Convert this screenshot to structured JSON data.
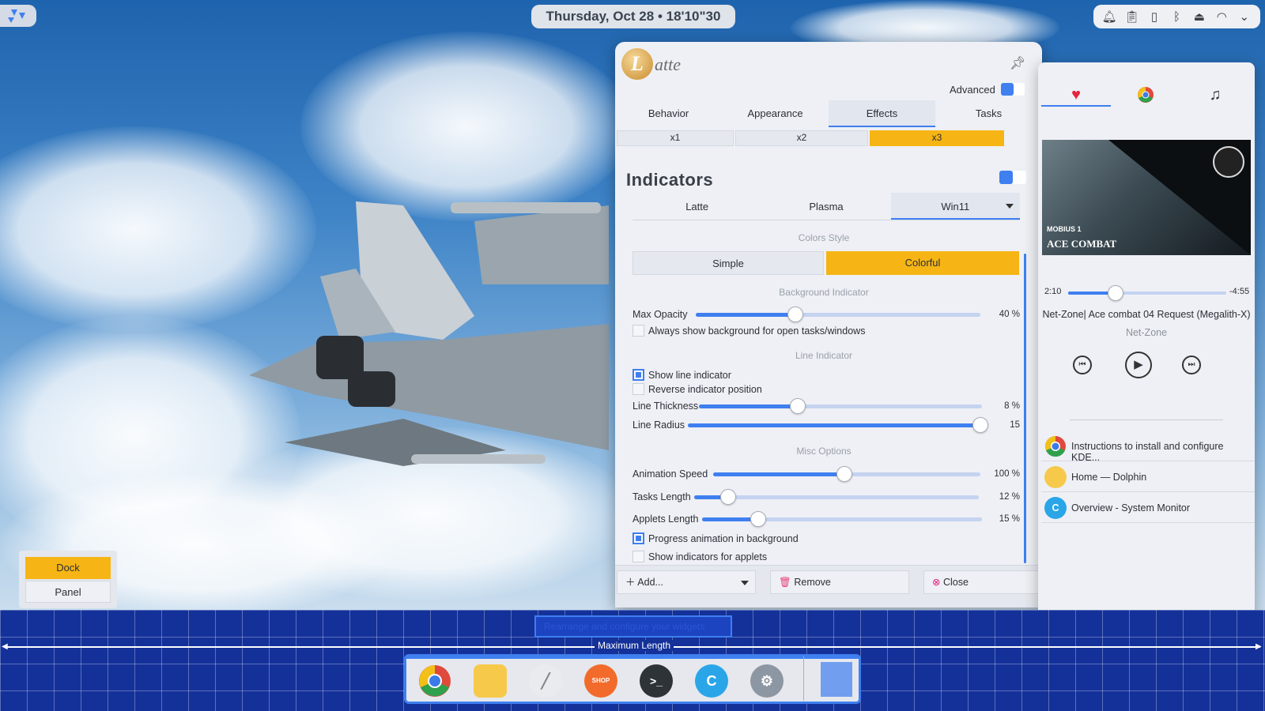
{
  "topbar": {
    "clock": "Thursday, Oct 28 • 18'10\"30"
  },
  "tray_icons": [
    "bell-icon",
    "clipboard-icon",
    "battery-icon",
    "bluetooth-icon",
    "usb-icon",
    "wifi-icon",
    "chevron-icon"
  ],
  "latte": {
    "logo_letter": "L",
    "logo_text": "atte",
    "advanced_label": "Advanced",
    "tabs": [
      "Behavior",
      "Appearance",
      "Effects",
      "Tasks"
    ],
    "active_tab": "Effects",
    "multipliers": [
      "x1",
      "x2",
      "x3"
    ],
    "indicators_title": "Indicators",
    "styles": [
      "Latte",
      "Plasma",
      "Win11"
    ],
    "colors_style_label": "Colors Style",
    "color_buttons": [
      "Simple",
      "Colorful"
    ],
    "bg_indicator_label": "Background Indicator",
    "max_opacity": {
      "label": "Max Opacity",
      "value": "40 %",
      "fraction": 0.35
    },
    "always_show_bg": "Always show background for open tasks/windows",
    "line_indicator_label": "Line Indicator",
    "show_line": "Show line indicator",
    "reverse_pos": "Reverse indicator position",
    "line_thickness": {
      "label": "Line Thickness",
      "value": "8 %",
      "fraction": 0.35
    },
    "line_radius": {
      "label": "Line Radius",
      "value": "15",
      "fraction": 1.0
    },
    "misc_label": "Misc Options",
    "anim_speed": {
      "label": "Animation Speed",
      "value": "100 %",
      "fraction": 0.49
    },
    "tasks_length": {
      "label": "Tasks Length",
      "value": "12 %",
      "fraction": 0.12
    },
    "applets_length": {
      "label": "Applets Length",
      "value": "15 %",
      "fraction": 0.2
    },
    "progress_anim": "Progress animation in background",
    "show_applets": "Show indicators for applets",
    "add_label": "Add...",
    "remove_label": "Remove",
    "close_label": "Close"
  },
  "player": {
    "elapsed": "2:10",
    "remaining": "-4:55",
    "progress": 0.3,
    "track": "Net-Zone| Ace combat 04 Request (Megalith-X)",
    "artist": "Net-Zone",
    "album_text": "ACE COMBAT",
    "album_sub": "MOBIUS 1"
  },
  "tasks": [
    {
      "title": "Instructions to install and configure KDE...",
      "icon": "chrome-icon"
    },
    {
      "title": "Home — Dolphin",
      "icon": "dolphin-folder-icon"
    },
    {
      "title": "Overview - System Monitor",
      "icon": "system-monitor-icon"
    }
  ],
  "edit": {
    "rearrange": "Rearrange and configure your widgets",
    "max_length": "Maximum Length"
  },
  "dock_apps": [
    "chrome-icon",
    "files-icon",
    "text-editor-icon",
    "shop-icon",
    "terminal-icon",
    "system-monitor-icon",
    "settings-icon"
  ],
  "dock_labels": {
    "shop": "SHOP",
    "terminal": ">_"
  },
  "mode": {
    "dock": "Dock",
    "panel": "Panel"
  },
  "colors": {
    "accent": "#3f7ff0",
    "selected": "#f6b514"
  }
}
